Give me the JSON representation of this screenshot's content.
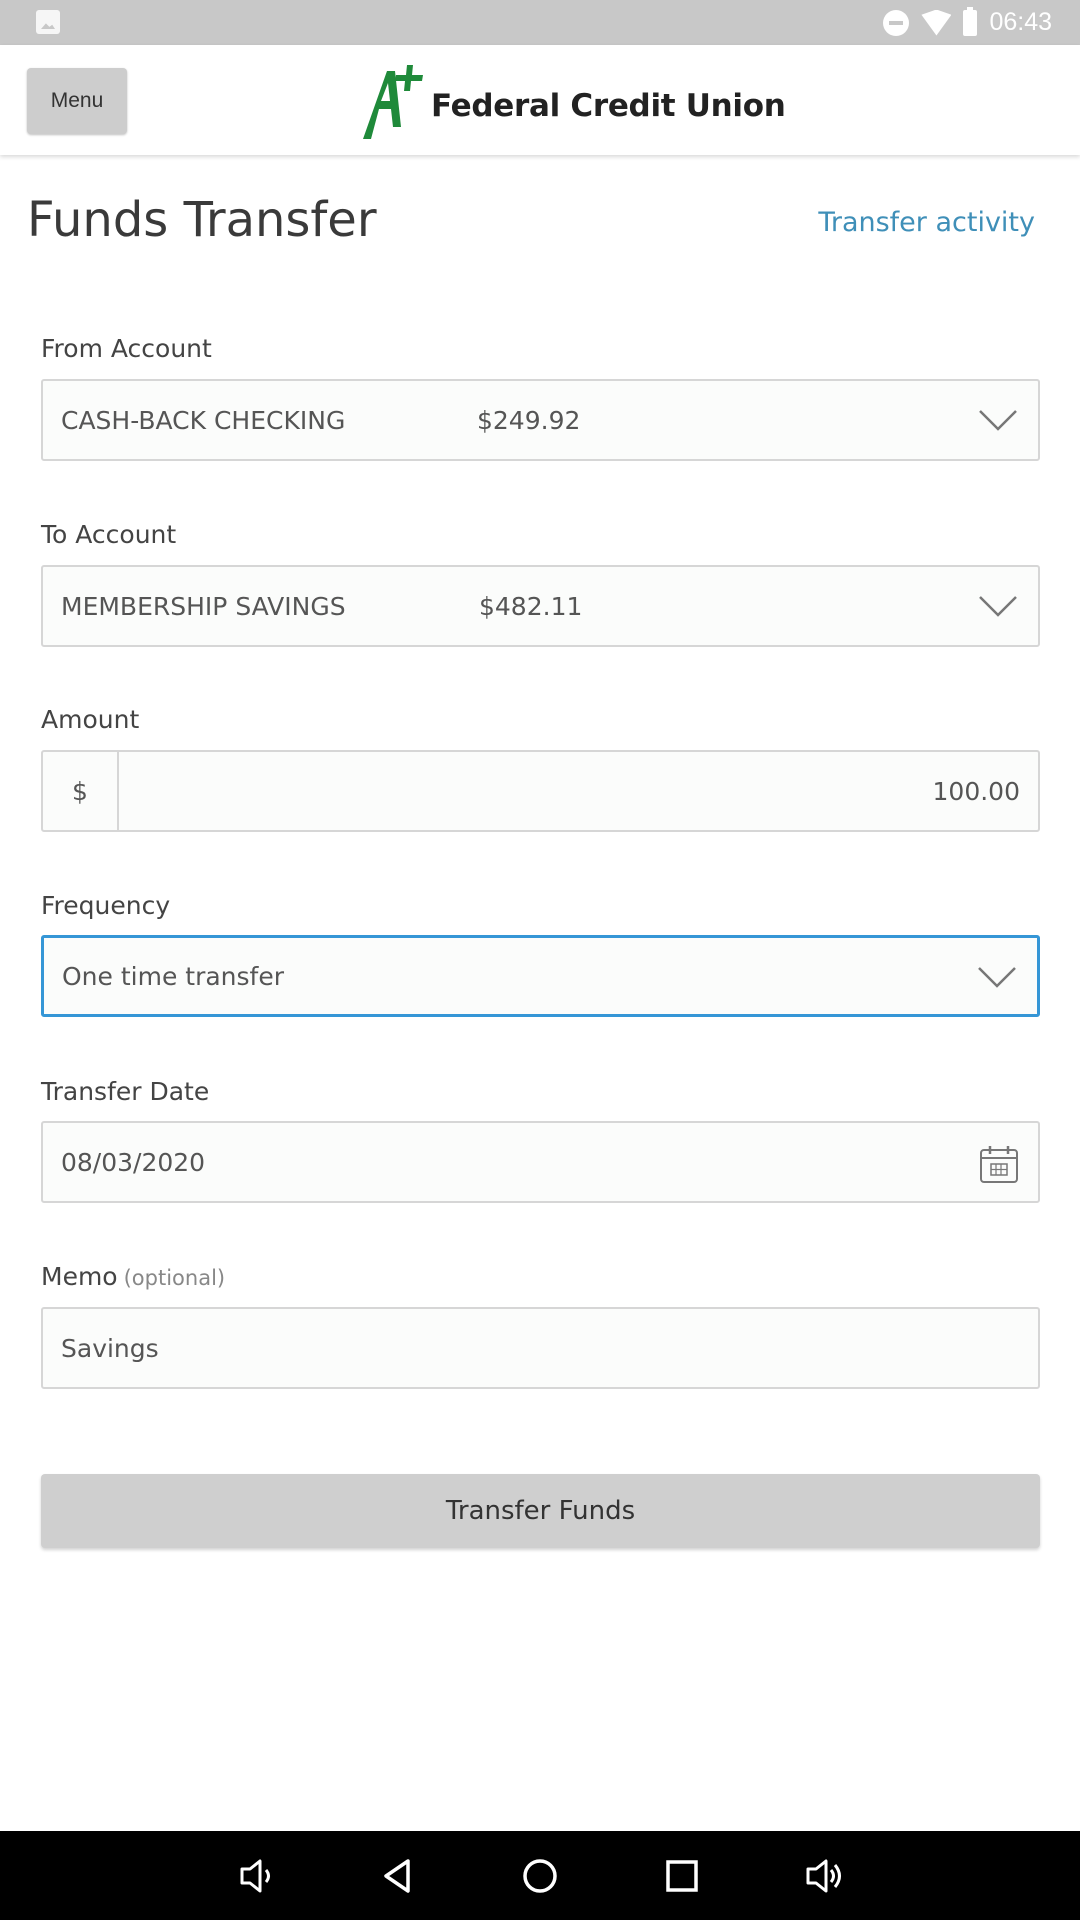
{
  "status_bar": {
    "time": "06:43"
  },
  "header": {
    "menu_label": "Menu",
    "logo_text": "Federal Credit Union"
  },
  "page": {
    "title": "Funds Transfer",
    "activity_link": "Transfer activity"
  },
  "form": {
    "from_account": {
      "label": "From Account",
      "name": "CASH-BACK CHECKING",
      "balance": "$249.92"
    },
    "to_account": {
      "label": "To Account",
      "name": "MEMBERSHIP SAVINGS",
      "balance": "$482.11"
    },
    "amount": {
      "label": "Amount",
      "currency_symbol": "$",
      "value": "100.00"
    },
    "frequency": {
      "label": "Frequency",
      "value": "One time transfer"
    },
    "transfer_date": {
      "label": "Transfer Date",
      "value": "08/03/2020"
    },
    "memo": {
      "label": "Memo",
      "optional_note": "(optional)",
      "value": "Savings"
    },
    "submit_label": "Transfer Funds"
  },
  "colors": {
    "link": "#3f8fb8",
    "focus_border": "#3596d6",
    "logo_green": "#1f8a3a"
  }
}
